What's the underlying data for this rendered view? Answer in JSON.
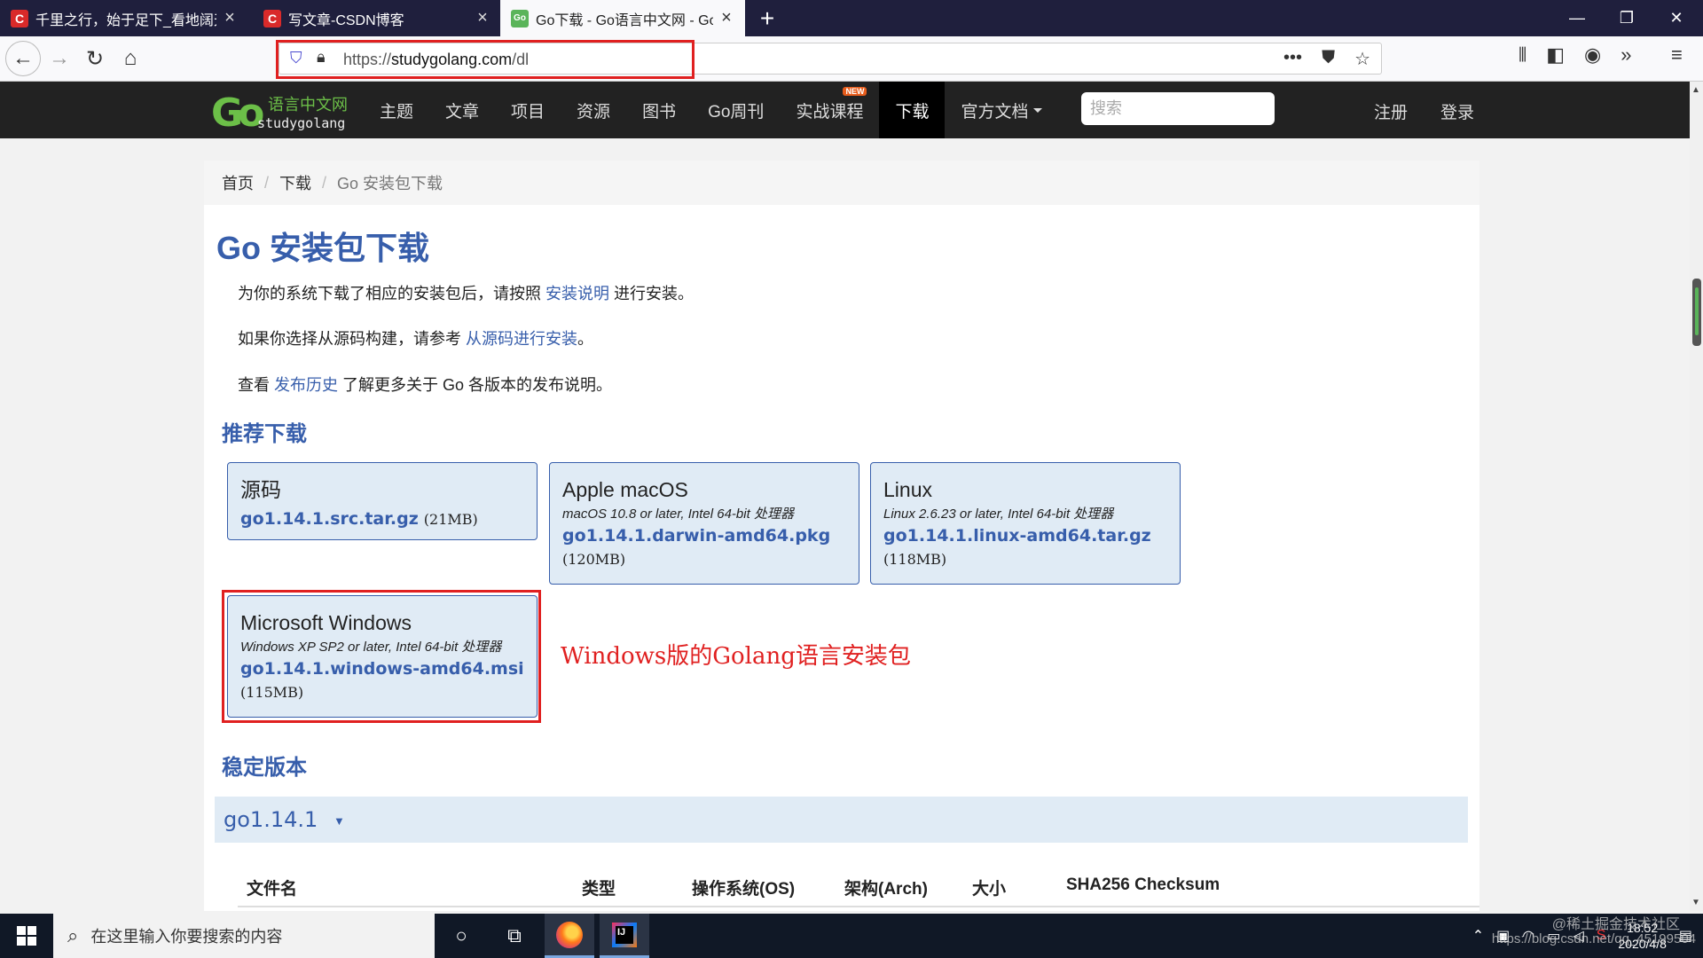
{
  "browser": {
    "tabs": [
      {
        "title": "千里之行，始于足下_看地阔天",
        "favicon": "csdn-icon",
        "active": false
      },
      {
        "title": "写文章-CSDN博客",
        "favicon": "csdn-icon",
        "active": false
      },
      {
        "title": "Go下载 - Go语言中文网 - Gol",
        "favicon": "golang-icon",
        "active": true
      }
    ],
    "new_tab": "+",
    "url_scheme": "https://",
    "url_host": "studygolang.com",
    "url_path": "/dl",
    "more_icon": "•••"
  },
  "site": {
    "logo_cn": "语言中文网",
    "logo_en": "studygolang",
    "logo_mark": "Go",
    "menu": [
      "主题",
      "文章",
      "项目",
      "资源",
      "图书",
      "Go周刊",
      "实战课程",
      "下载",
      "官方文档"
    ],
    "new_badge": "NEW",
    "search_placeholder": "搜索",
    "register": "注册",
    "login": "登录"
  },
  "breadcrumb": {
    "home": "首页",
    "download": "下载",
    "current": "Go 安装包下载"
  },
  "page": {
    "title": "Go 安装包下载",
    "p1_pre": "为你的系统下载了相应的安装包后，请按照 ",
    "p1_link": "安装说明",
    "p1_post": " 进行安装。",
    "p2_pre": "如果你选择从源码构建，请参考 ",
    "p2_link": "从源码进行安装",
    "p2_post": "。",
    "p3_pre": "查看 ",
    "p3_link": "发布历史",
    "p3_post": " 了解更多关于 Go 各版本的发布说明。",
    "featured_title": "推荐下载",
    "stable_title": "稳定版本"
  },
  "downloads": {
    "source": {
      "os": "源码",
      "file": "go1.14.1.src.tar.gz",
      "size": "(21MB)"
    },
    "macos": {
      "os": "Apple macOS",
      "platform": "macOS 10.8 or later, Intel 64-bit 处理器",
      "file": "go1.14.1.darwin-amd64.pkg",
      "size": "(120MB)"
    },
    "linux": {
      "os": "Linux",
      "platform": "Linux 2.6.23 or later, Intel 64-bit 处理器",
      "file": "go1.14.1.linux-amd64.tar.gz",
      "size": "(118MB)"
    },
    "windows": {
      "os": "Microsoft Windows",
      "platform": "Windows XP SP2 or later, Intel 64-bit 处理器",
      "file": "go1.14.1.windows-amd64.msi",
      "size": "(115MB)"
    }
  },
  "annotation": "Windows版的Golang语言安装包",
  "version": {
    "label": "go1.14.1",
    "toggle": "▼"
  },
  "table": {
    "headers": [
      "文件名",
      "类型",
      "操作系统(OS)",
      "架构(Arch)",
      "大小",
      "SHA256 Checksum"
    ]
  },
  "taskbar": {
    "search_placeholder": "在这里输入你要搜索的内容",
    "time": "18:52",
    "date": "2020/4/8"
  },
  "watermark": {
    "line1": "@稀土掘金技术社区",
    "line2": "https://blog.csdn.net/qq_45199504"
  },
  "colors": {
    "accent": "#375eab",
    "card_bg": "#e0ebf5",
    "highlight": "#e02020",
    "header_bg": "#222222"
  }
}
